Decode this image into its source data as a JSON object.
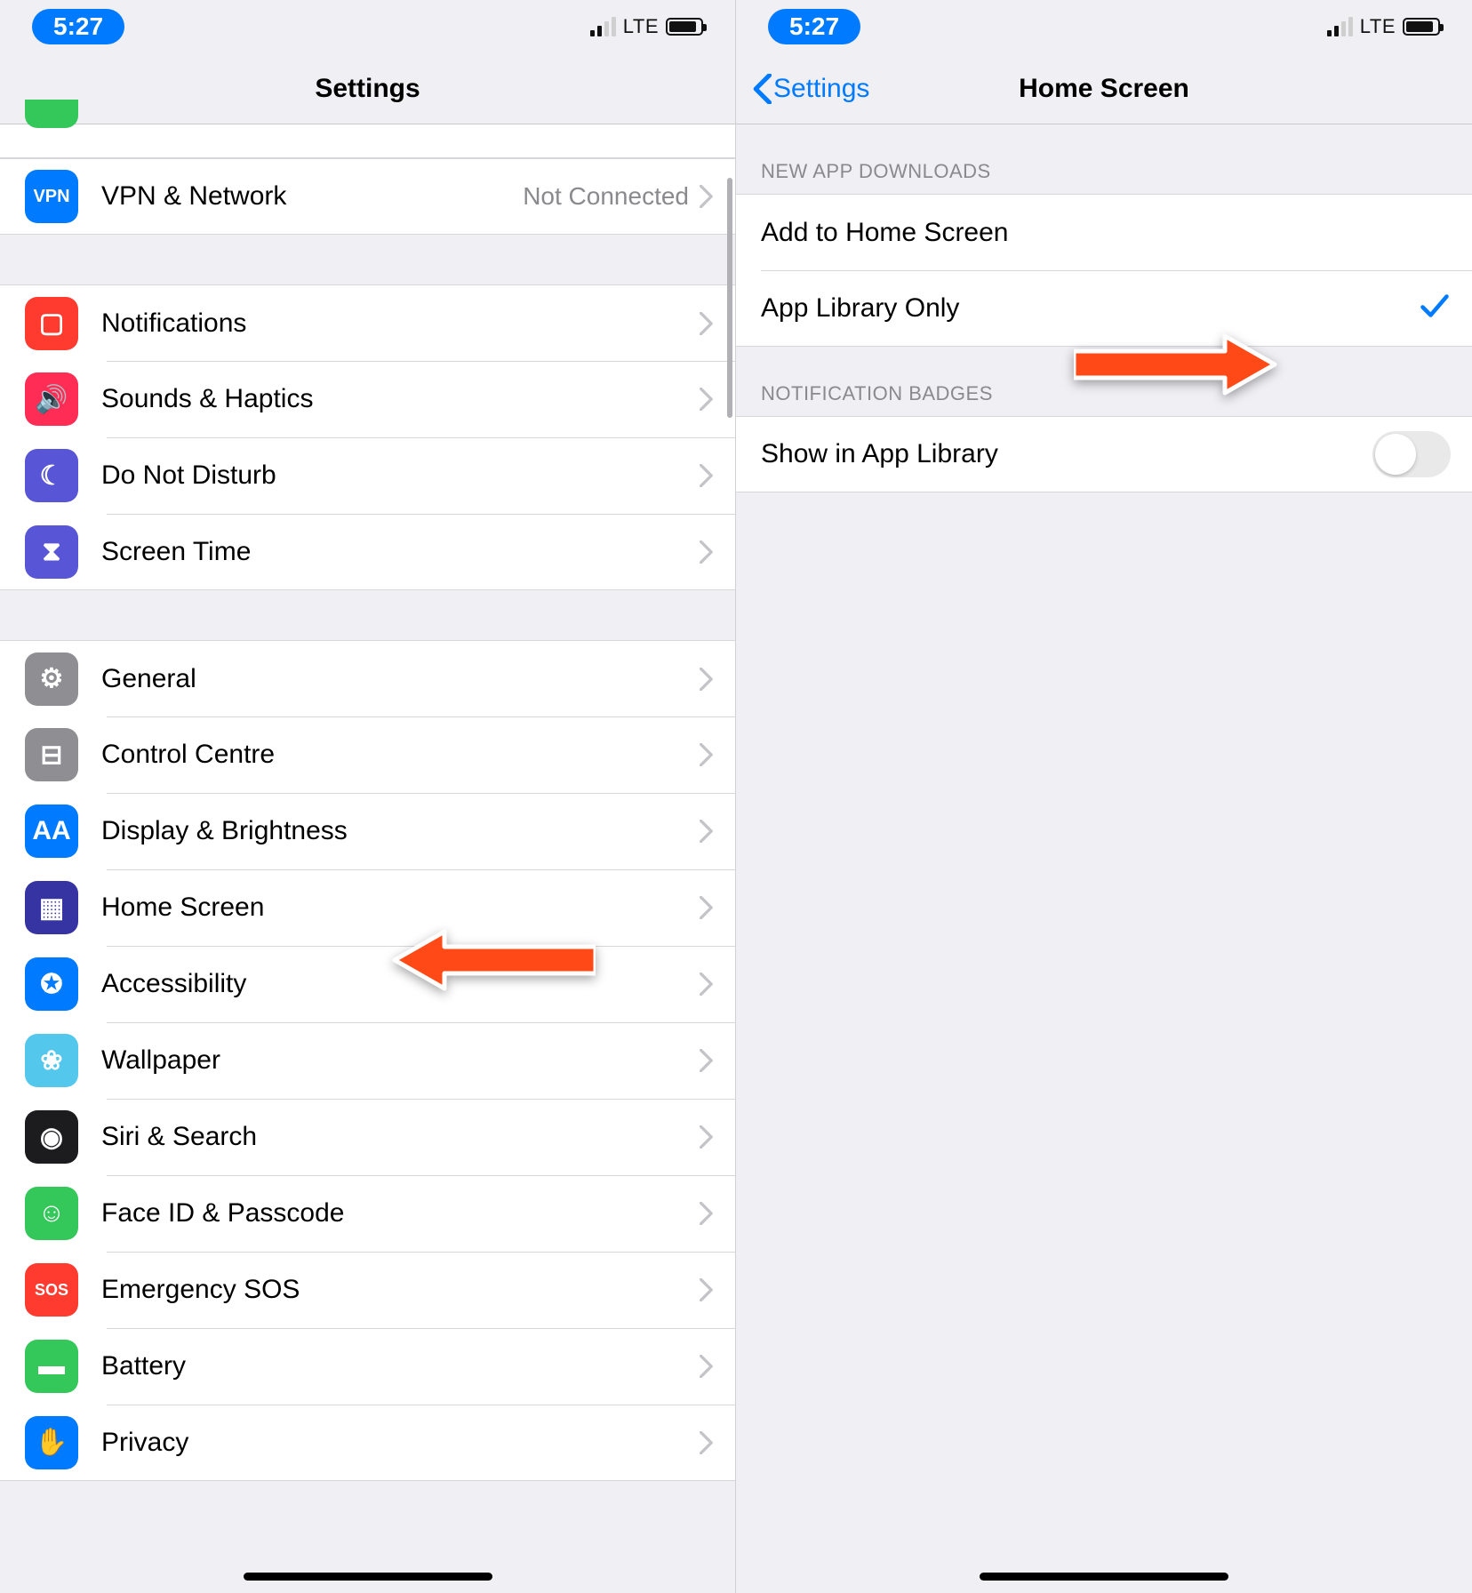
{
  "statusbar": {
    "time": "5:27",
    "network": "LTE"
  },
  "left": {
    "title": "Settings",
    "vpn": {
      "label": "VPN & Network",
      "detail": "Not Connected",
      "icon": "vpn-icon",
      "iconText": "VPN",
      "color": "#007aff"
    },
    "group_notifications": [
      {
        "label": "Notifications",
        "icon": "notifications-icon",
        "color": "#ff3b30",
        "glyph": "▢"
      },
      {
        "label": "Sounds & Haptics",
        "icon": "sounds-icon",
        "color": "#ff2d55",
        "glyph": "🔊"
      },
      {
        "label": "Do Not Disturb",
        "icon": "dnd-icon",
        "color": "#5856d6",
        "glyph": "☾"
      },
      {
        "label": "Screen Time",
        "icon": "screentime-icon",
        "color": "#5856d6",
        "glyph": "⧗"
      }
    ],
    "group_general": [
      {
        "label": "General",
        "icon": "general-icon",
        "color": "#8e8e93",
        "glyph": "⚙"
      },
      {
        "label": "Control Centre",
        "icon": "control-centre-icon",
        "color": "#8e8e93",
        "glyph": "⊟"
      },
      {
        "label": "Display & Brightness",
        "icon": "display-icon",
        "color": "#007aff",
        "glyph": "AA"
      },
      {
        "label": "Home Screen",
        "icon": "home-screen-icon",
        "color": "#3634a3",
        "glyph": "▦"
      },
      {
        "label": "Accessibility",
        "icon": "accessibility-icon",
        "color": "#007aff",
        "glyph": "✪"
      },
      {
        "label": "Wallpaper",
        "icon": "wallpaper-icon",
        "color": "#54c7ec",
        "glyph": "❀"
      },
      {
        "label": "Siri & Search",
        "icon": "siri-icon",
        "color": "#1c1c1e",
        "glyph": "◉"
      },
      {
        "label": "Face ID & Passcode",
        "icon": "faceid-icon",
        "color": "#34c759",
        "glyph": "☺"
      },
      {
        "label": "Emergency SOS",
        "icon": "sos-icon",
        "color": "#ff3b30",
        "glyph": "SOS"
      },
      {
        "label": "Battery",
        "icon": "battery-icon",
        "color": "#34c759",
        "glyph": "▬"
      },
      {
        "label": "Privacy",
        "icon": "privacy-icon",
        "color": "#007aff",
        "glyph": "✋"
      }
    ]
  },
  "right": {
    "back": "Settings",
    "title": "Home Screen",
    "section1_header": "NEW APP DOWNLOADS",
    "section1_options": [
      {
        "label": "Add to Home Screen",
        "selected": false
      },
      {
        "label": "App Library Only",
        "selected": true
      }
    ],
    "section2_header": "NOTIFICATION BADGES",
    "section2_row": {
      "label": "Show in App Library",
      "on": false
    }
  }
}
